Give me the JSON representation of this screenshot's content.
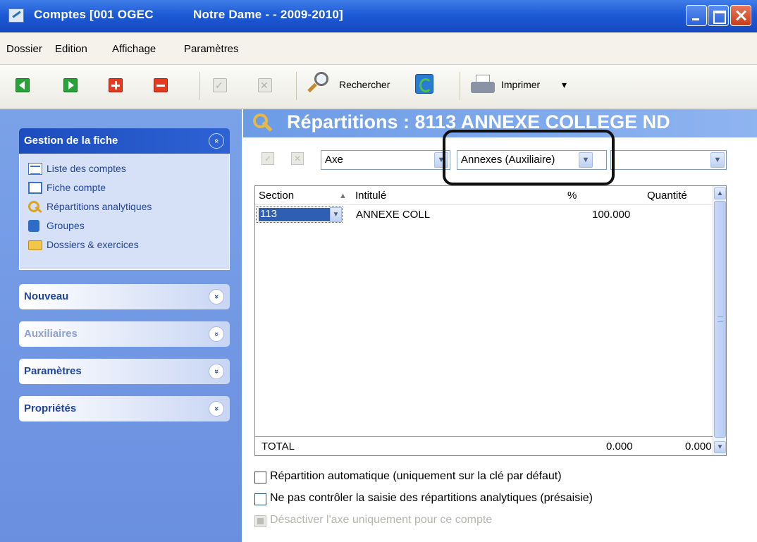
{
  "window": {
    "title_part1": "Comptes [001 OGEC",
    "title_part2": "Notre Dame - - 2009-2010]"
  },
  "menu": [
    "Dossier",
    "Edition",
    "Affichage",
    "Paramètres"
  ],
  "toolbar": {
    "search_label": "Rechercher",
    "print_label": "Imprimer",
    "print_dropdown": "▾"
  },
  "sidebar": {
    "groups": [
      {
        "title": "Gestion de la fiche",
        "expanded": true,
        "links": [
          "Liste des comptes",
          "Fiche compte",
          "Répartitions analytiques",
          "Groupes",
          "Dossiers & exercices"
        ]
      },
      {
        "title": "Nouveau",
        "expanded": false
      },
      {
        "title": "Auxiliaires",
        "expanded": false,
        "disabled": true
      },
      {
        "title": "Paramètres",
        "expanded": false
      },
      {
        "title": "Propriétés",
        "expanded": false
      }
    ],
    "chevron_up": "«",
    "chevron_down": "»"
  },
  "main": {
    "banner_title": "Répartitions : 8113 ANNEXE COLLEGE ND",
    "axe_combo": "Axe",
    "axe_value_combo": "Annexes (Auxiliaire)",
    "third_combo": "",
    "grid": {
      "headers": [
        "Section",
        "Intitulé",
        "%",
        "Quantité"
      ],
      "sort_indicator": "▲",
      "rows": [
        {
          "section": "113",
          "intitule": "ANNEXE COLL",
          "percent": "100.000",
          "quantite": ""
        }
      ],
      "total_label": "TOTAL",
      "total_percent": "0.000",
      "total_quantite": "0.000"
    },
    "options": [
      {
        "label": "Répartition automatique (uniquement sur la clé par défaut)",
        "checked": false,
        "enabled": true
      },
      {
        "label": "Ne pas contrôler la saisie des répartitions analytiques (présaisie)",
        "checked": false,
        "enabled": true
      },
      {
        "label": "Désactiver l'axe uniquement pour ce compte",
        "checked": false,
        "enabled": false
      }
    ]
  },
  "colors": {
    "titlebar": "#1d5ad6",
    "sidebar_bg": "#7aa2e8",
    "banner_bg": "#6c9be6",
    "selection": "#2f5fb3"
  }
}
